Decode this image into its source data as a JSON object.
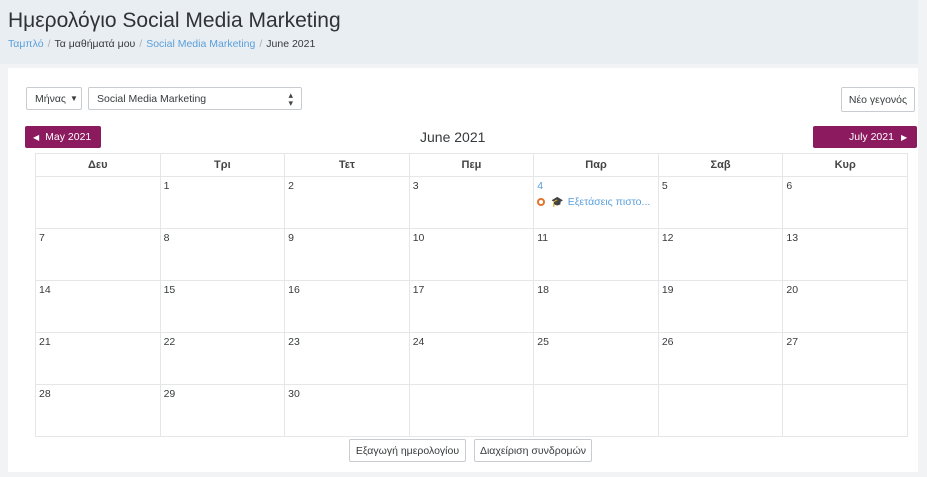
{
  "header": {
    "title": "Ημερολόγιο Social Media Marketing",
    "breadcrumb": [
      {
        "label": "Ταμπλό",
        "link": true
      },
      {
        "label": "Τα μαθήματά μου",
        "link": false
      },
      {
        "label": "Social Media Marketing",
        "link": true
      },
      {
        "label": "June 2021",
        "link": false
      }
    ]
  },
  "controls": {
    "view_label": "Μήνας",
    "course_select_value": "Social Media Marketing",
    "new_event_label": "Νέο γεγονός"
  },
  "nav": {
    "prev_label": "May 2021",
    "next_label": "July 2021",
    "current_month": "June 2021"
  },
  "calendar": {
    "weekdays": [
      "Δευ",
      "Τρι",
      "Τετ",
      "Πεμ",
      "Παρ",
      "Σαβ",
      "Κυρ"
    ],
    "weeks": [
      [
        "",
        "1",
        "2",
        "3",
        "4",
        "5",
        "6"
      ],
      [
        "7",
        "8",
        "9",
        "10",
        "11",
        "12",
        "13"
      ],
      [
        "14",
        "15",
        "16",
        "17",
        "18",
        "19",
        "20"
      ],
      [
        "21",
        "22",
        "23",
        "24",
        "25",
        "26",
        "27"
      ],
      [
        "28",
        "29",
        "30",
        "",
        "",
        "",
        ""
      ]
    ],
    "today": "4",
    "events": [
      {
        "day": "4",
        "title": "Εξετάσεις πιστο...",
        "type_icon": "graduation-cap-icon",
        "color": "#e2742e"
      }
    ]
  },
  "footer": {
    "export_label": "Εξαγωγή ημερολογίου",
    "subscriptions_label": "Διαχείριση συνδρομών"
  },
  "colors": {
    "accent": "#8b1a5e",
    "link": "#5a9fdc",
    "event_dot": "#e2742e"
  }
}
